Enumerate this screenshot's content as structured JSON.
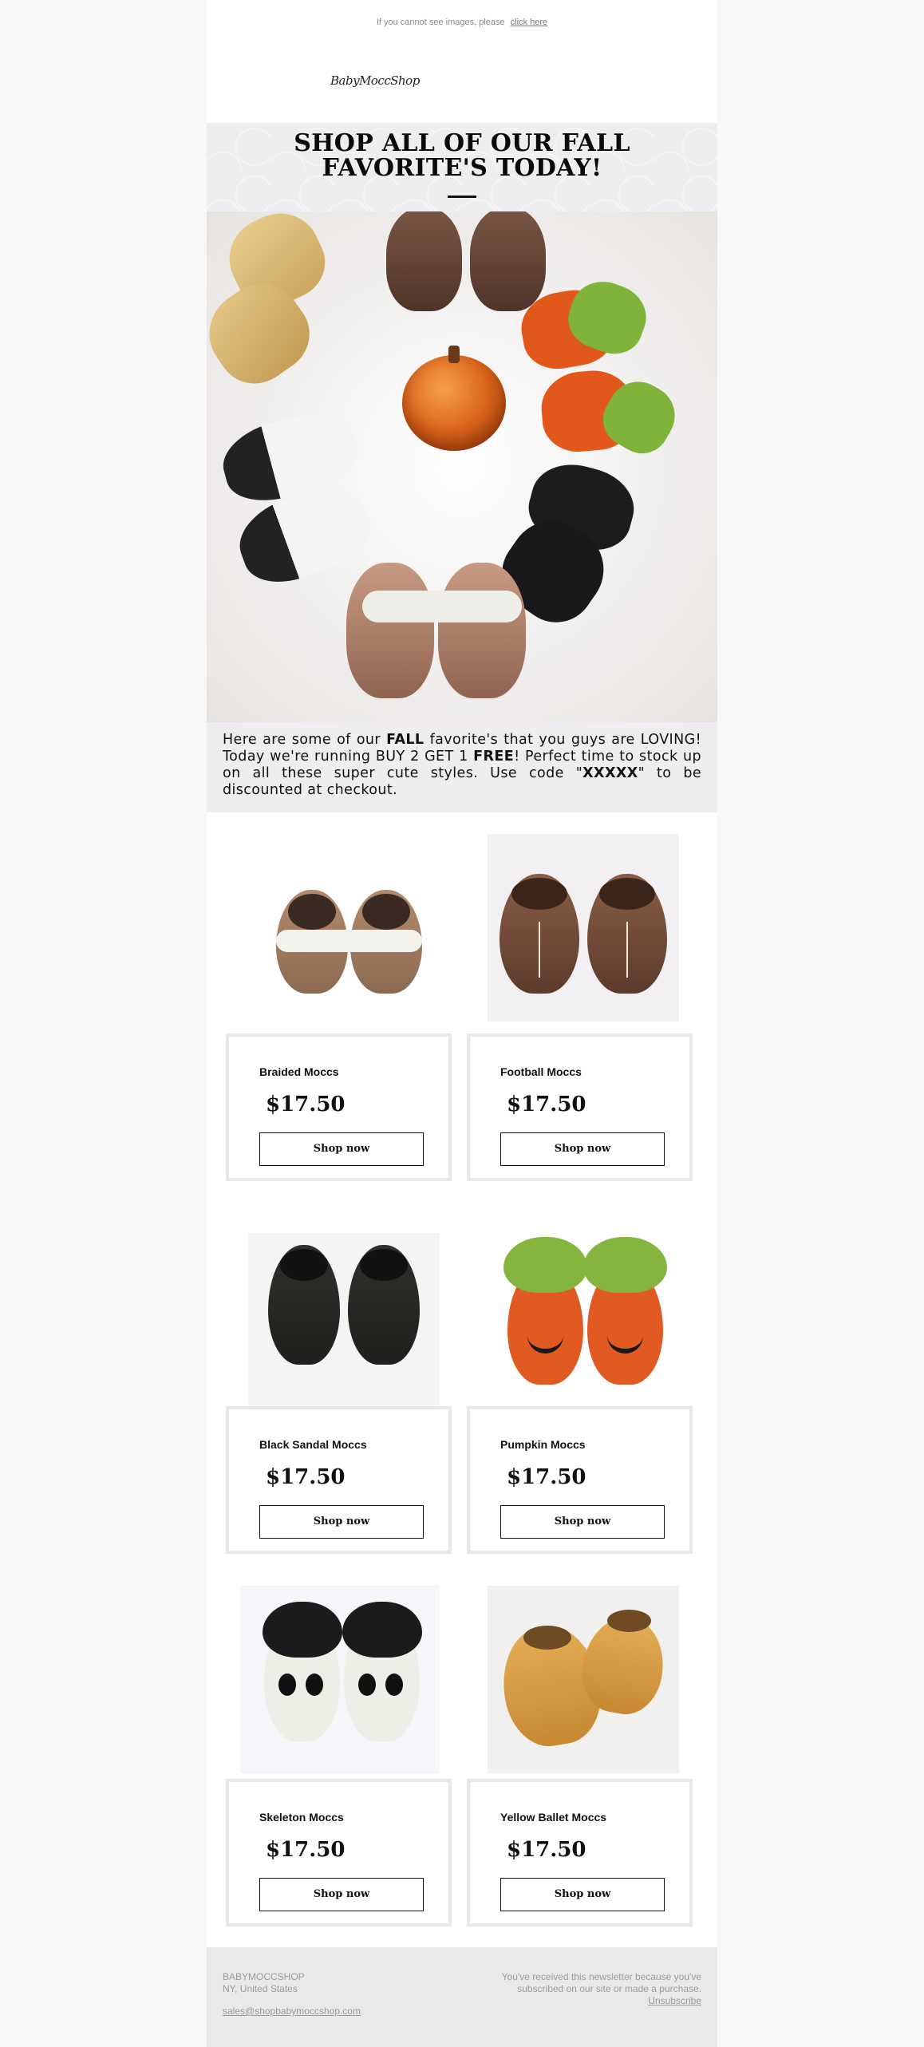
{
  "preheader": {
    "text": "If you cannot see images, please",
    "link_label": "click here"
  },
  "logo": {
    "text": "BabyMoccShop"
  },
  "hero": {
    "title": "SHOP ALL OF OUR FALL FAVORITE'S TODAY!"
  },
  "intro": {
    "part1": "Here are some of our ",
    "bold1": "FALL",
    "part2": " favorite's that you guys are LOVING! Today we're running BUY 2 GET 1 ",
    "bold2": "FREE",
    "part3": "! Perfect time to stock up on all these super cute styles. Use code \"",
    "bold3": "XXXXX",
    "part4": "\" to be discounted at checkout."
  },
  "products": [
    {
      "name": "Braided Moccs",
      "price": "$17.50",
      "button": "Shop now"
    },
    {
      "name": "Football Moccs",
      "price": "$17.50",
      "button": "Shop now"
    },
    {
      "name": "Black Sandal Moccs",
      "price": "$17.50",
      "button": "Shop now"
    },
    {
      "name": "Pumpkin Moccs",
      "price": "$17.50",
      "button": "Shop now"
    },
    {
      "name": "Skeleton Moccs",
      "price": "$17.50",
      "button": "Shop now"
    },
    {
      "name": "Yellow Ballet Moccs",
      "price": "$17.50",
      "button": "Shop now"
    }
  ],
  "footer": {
    "company": "BABYMOCCSHOP",
    "location": "NY, United States",
    "email": "sales@shopbabymoccshop.com",
    "notice": "You've received this newsletter because you've subscribed on our site or made a purchase.",
    "unsubscribe": "Unsubscribe"
  },
  "colors": {
    "band": "#eeeef0",
    "footer_bg": "#e9e9e9",
    "card_border": "#e8e8e8"
  }
}
